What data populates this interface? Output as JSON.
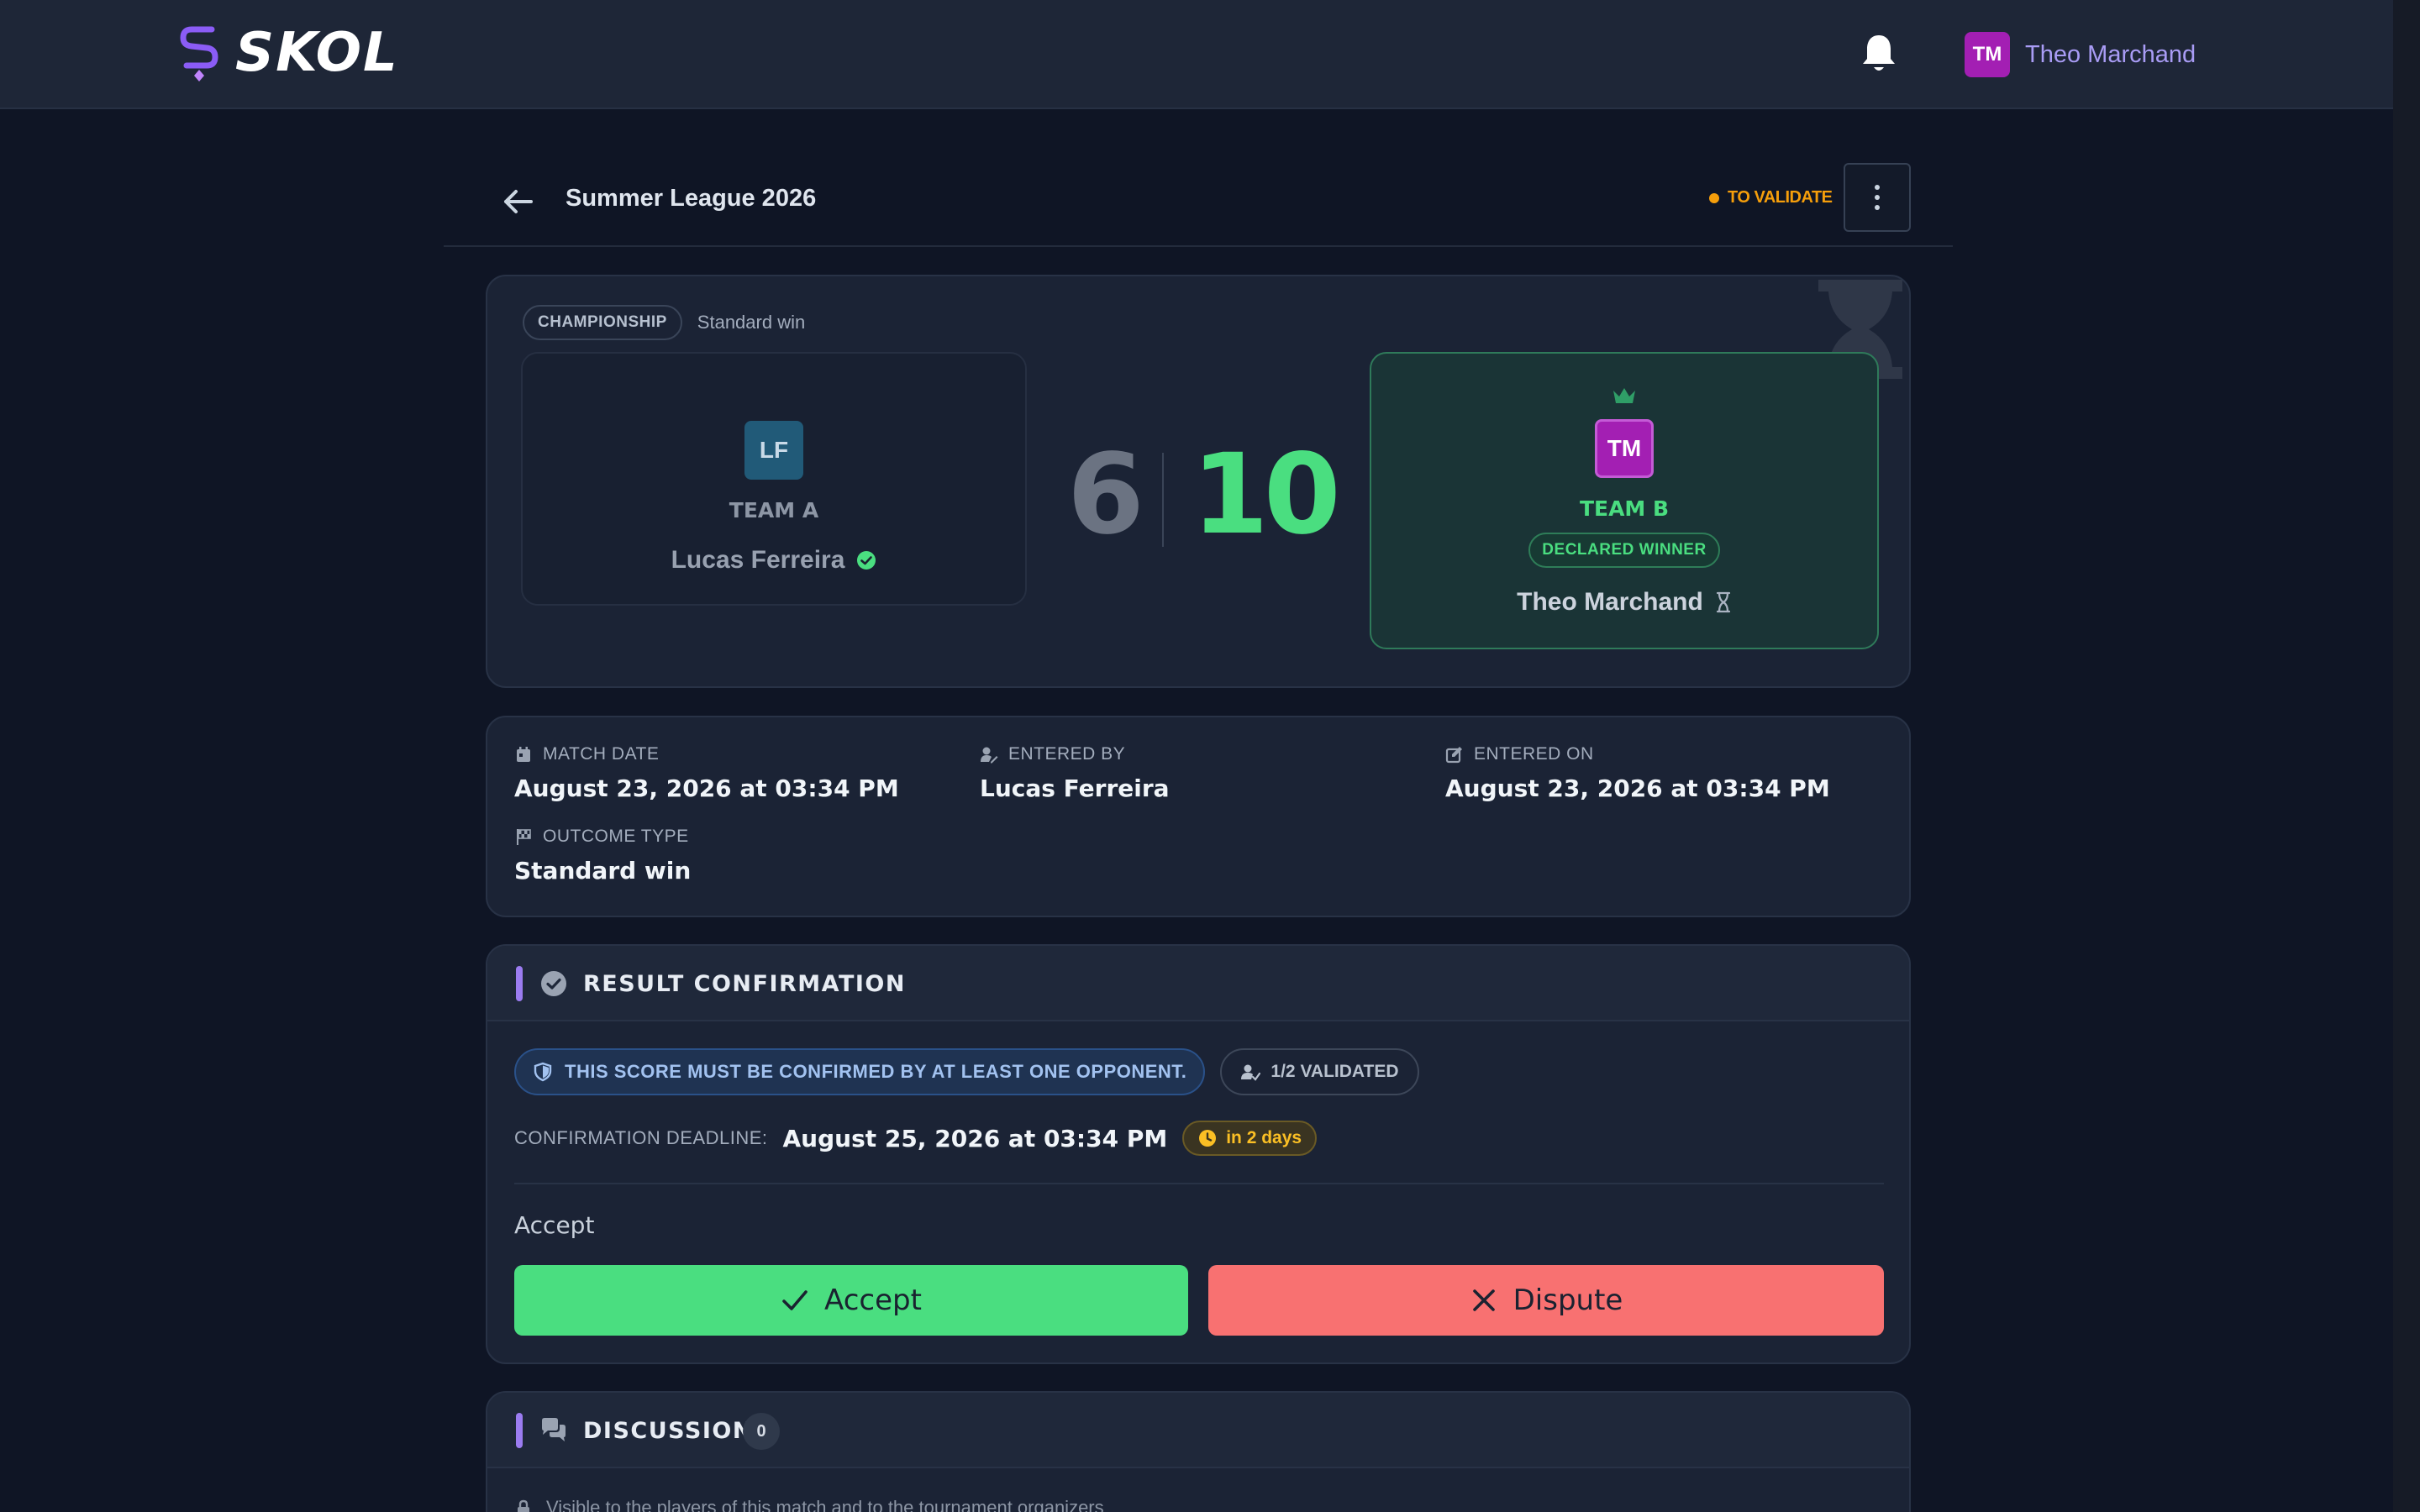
{
  "app": {
    "name": "SKOL"
  },
  "user": {
    "initials": "TM",
    "name": "Theo Marchand"
  },
  "header": {
    "title": "Summer League 2026",
    "status": "TO VALIDATE"
  },
  "colors": {
    "accent": "#9b7cf0",
    "win": "#4ade80",
    "loss": "#f87171",
    "warning": "#f59e0b"
  },
  "match": {
    "competition_tag": "CHAMPIONSHIP",
    "outcome_label": "Standard win",
    "team_a": {
      "initials": "LF",
      "label": "TEAM A",
      "player": "Lucas Ferreira",
      "score": "6",
      "status_icon": "check-circle-icon"
    },
    "team_b": {
      "initials": "TM",
      "label": "TEAM B",
      "player": "Theo Marchand",
      "score": "10",
      "winner_badge": "DECLARED WINNER",
      "status_icon": "hourglass-icon"
    }
  },
  "details": {
    "match_date": {
      "label": "MATCH DATE",
      "value": "August 23, 2026 at 03:34 PM"
    },
    "entered_by": {
      "label": "ENTERED BY",
      "value": "Lucas Ferreira"
    },
    "entered_on": {
      "label": "ENTERED ON",
      "value": "August 23, 2026 at 03:34 PM"
    },
    "outcome_type": {
      "label": "OUTCOME TYPE",
      "value": "Standard win"
    }
  },
  "confirmation": {
    "title": "RESULT CONFIRMATION",
    "rule": "THIS SCORE MUST BE CONFIRMED BY AT LEAST ONE OPPONENT.",
    "validated": "1/2 VALIDATED",
    "deadline_label": "CONFIRMATION DEADLINE:",
    "deadline_value": "August 25, 2026 at 03:34 PM",
    "due_in": "in 2 days",
    "action_heading": "Accept",
    "accept_label": "Accept",
    "dispute_label": "Dispute"
  },
  "discussion": {
    "title": "DISCUSSION",
    "count": "0",
    "visibility_note": "Visible to the players of this match and to the tournament organizers"
  }
}
